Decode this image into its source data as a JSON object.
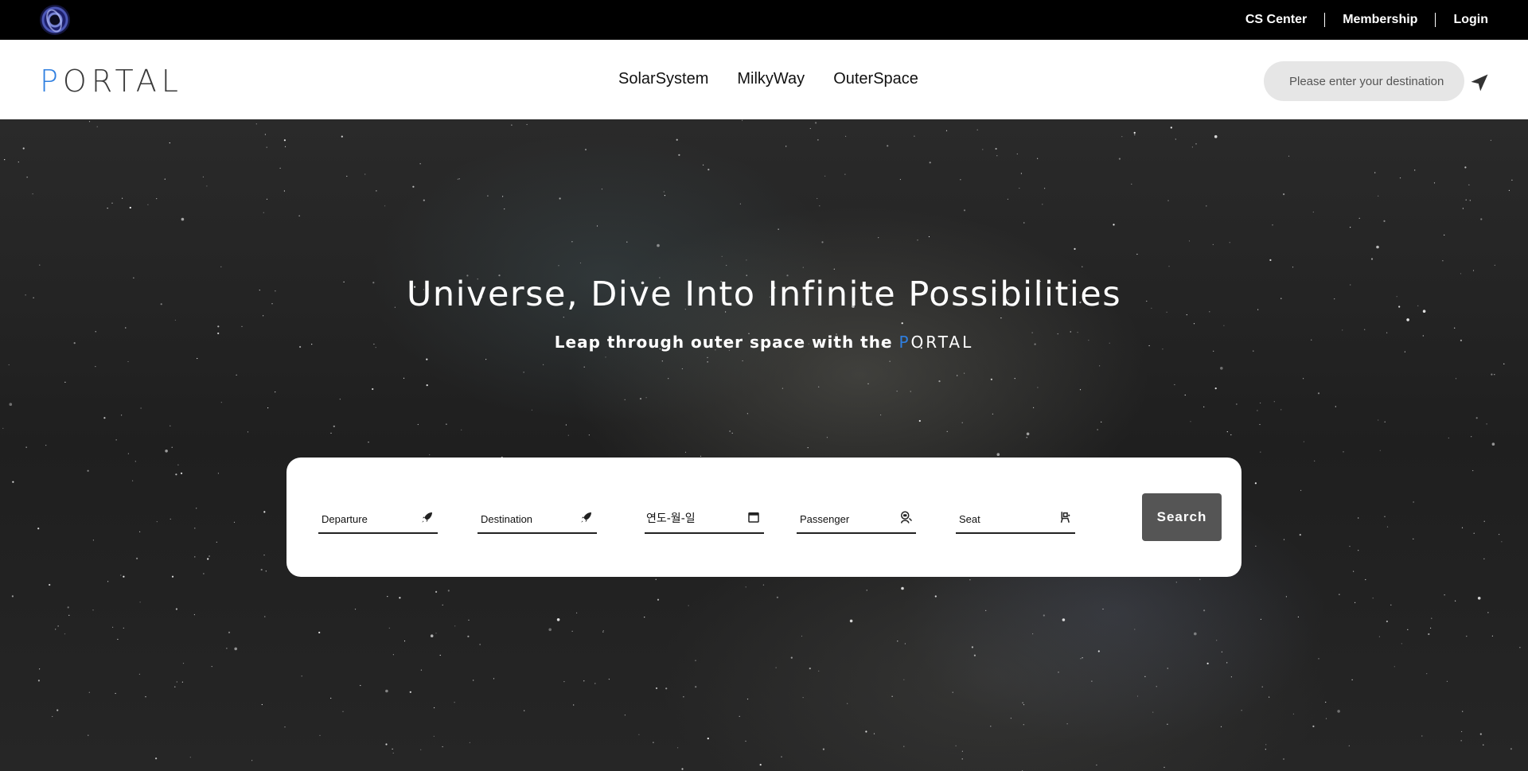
{
  "topbar": {
    "logo_icon": "portal-ring-logo-icon",
    "links": [
      "CS Center",
      "Membership",
      "Login"
    ]
  },
  "navbar": {
    "brand_first": "P",
    "brand_rest": "ORTAL",
    "menu": [
      "SolarSystem",
      "MilkyWay",
      "OuterSpace"
    ],
    "search_placeholder": "Please enter your destination",
    "send_icon": "paper-plane-icon"
  },
  "hero": {
    "title": "Universe, Dive Into Infinite Possibilities",
    "subtitle": "Leap through outer space with the ",
    "subtitle_brand_first": "P",
    "subtitle_brand_rest": "ORTAL"
  },
  "booking": {
    "departure_placeholder": "Departure",
    "destination_placeholder": "Destination",
    "date_placeholder": "연도-월-일",
    "passenger_placeholder": "Passenger",
    "seat_placeholder": "Seat",
    "search_label": "Search",
    "icons": {
      "departure": "rocket-icon",
      "destination": "rocket-icon",
      "date": "calendar-icon",
      "passenger": "astronaut-icon",
      "seat": "seat-icon"
    }
  },
  "colors": {
    "accent": "#2f7fe0",
    "topbar_bg": "#000000",
    "search_button": "#555555"
  }
}
